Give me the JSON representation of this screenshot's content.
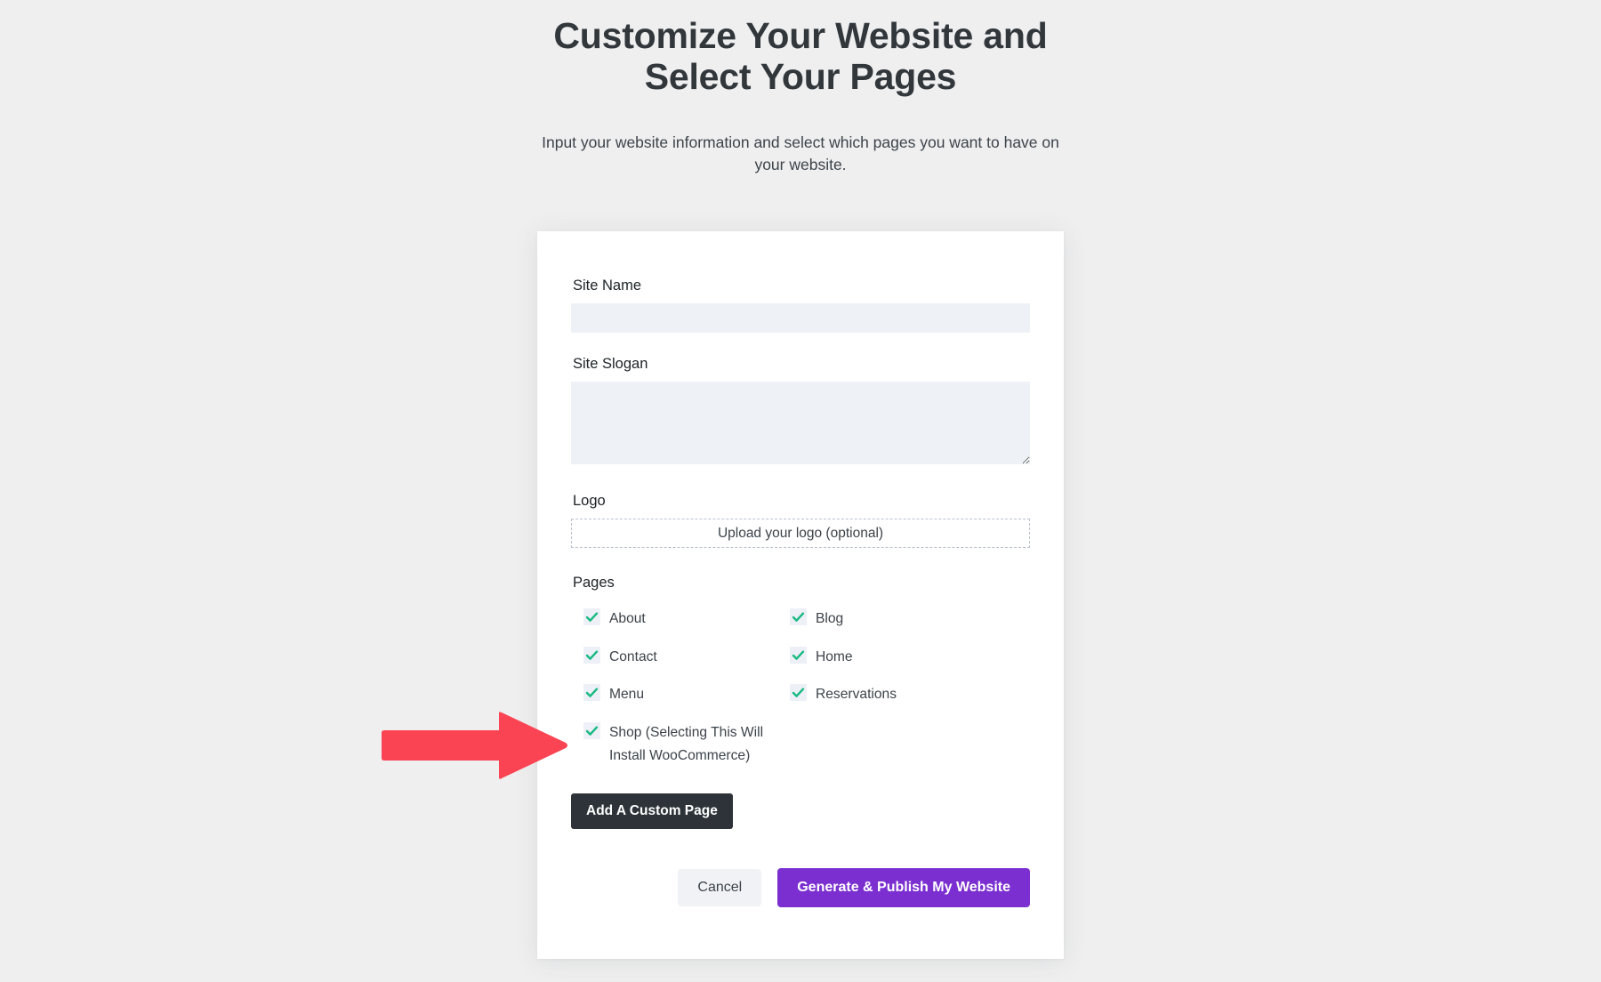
{
  "header": {
    "title": "Customize Your Website and Select Your Pages",
    "subtitle": "Input your website information and select which pages you want to have on your website."
  },
  "form": {
    "site_name": {
      "label": "Site Name",
      "value": "",
      "placeholder": ""
    },
    "site_slogan": {
      "label": "Site Slogan",
      "value": "",
      "placeholder": ""
    },
    "logo": {
      "label": "Logo",
      "upload_text": "Upload your logo (optional)"
    },
    "pages": {
      "label": "Pages",
      "options": [
        {
          "label": "About",
          "checked": true
        },
        {
          "label": "Blog",
          "checked": true
        },
        {
          "label": "Contact",
          "checked": true
        },
        {
          "label": "Home",
          "checked": true
        },
        {
          "label": "Menu",
          "checked": true
        },
        {
          "label": "Reservations",
          "checked": true
        },
        {
          "label": "Shop (Selecting This Will Install WooCommerce)",
          "checked": true
        }
      ]
    },
    "add_custom_page_label": "Add A Custom Page"
  },
  "actions": {
    "cancel_label": "Cancel",
    "publish_label": "Generate & Publish My Website"
  },
  "annotation": {
    "arrow": "right-arrow",
    "color": "#fa4453"
  },
  "colors": {
    "background": "#efefef",
    "card": "#ffffff",
    "input_fill": "#eef2f6",
    "checkbox_fill": "#eef0f7",
    "check_mark": "#17b981",
    "primary_button": "#7b2fd0",
    "dark_button": "#2d3338",
    "cancel_button": "#f1f2f6",
    "text": "#3c434a",
    "heading": "#32373c"
  }
}
